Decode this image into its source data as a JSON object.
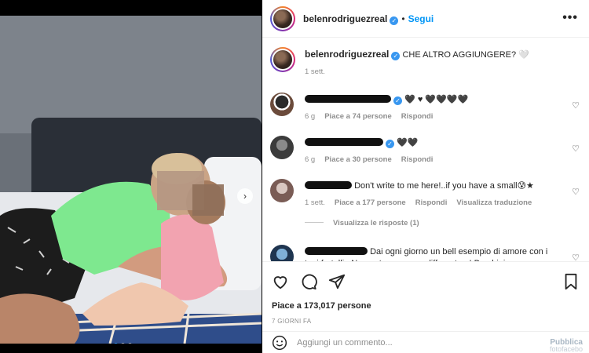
{
  "post": {
    "username": "belenrodriguezreal",
    "follow_label": "Segui",
    "separator": "•",
    "more_label": "•••",
    "caption": "CHE ALTRO AGGIUNGERE? 🤍",
    "caption_age": "1 sett."
  },
  "comments": [
    {
      "text_tail": "🖤 ♥ 🖤🖤🖤🖤",
      "age": "6 g",
      "likes": "Piace a 74 persone",
      "reply": "Rispondi",
      "translate": "",
      "verified": true
    },
    {
      "text_tail": "🖤🖤",
      "age": "6 g",
      "likes": "Piace a 30 persone",
      "reply": "Rispondi",
      "translate": "",
      "verified": true
    },
    {
      "text_tail": "Don't write to me here!..if you have a small😰★",
      "age": "1 sett.",
      "likes": "Piace a 177 persone",
      "reply": "Rispondi",
      "translate": "Visualizza traduzione",
      "verified": false
    },
    {
      "text_tail": "Dai ogni giorno un bell esempio di amore con i tuoi fratelli . Non poteva essere differente . I Bambini sono",
      "age": "",
      "likes": "",
      "reply": "",
      "translate": "",
      "verified": false
    }
  ],
  "view_replies": "Visualizza le risposte (1)",
  "likes_total": "Piace a 173,017 persone",
  "date_label": "7 GIORNI FA",
  "add_comment_placeholder": "Aggiungi un commento...",
  "publish_label": "Pubblica",
  "watermark": "fotofacebo",
  "carousel_arrow": "›",
  "colors": {
    "link": "#0095f6",
    "verified": "#3897f0",
    "muted": "#8e8e8e"
  },
  "icons": [
    "heart-icon",
    "comment-icon",
    "share-icon",
    "bookmark-icon",
    "emoji-icon",
    "more-icon",
    "chevron-right-icon"
  ]
}
